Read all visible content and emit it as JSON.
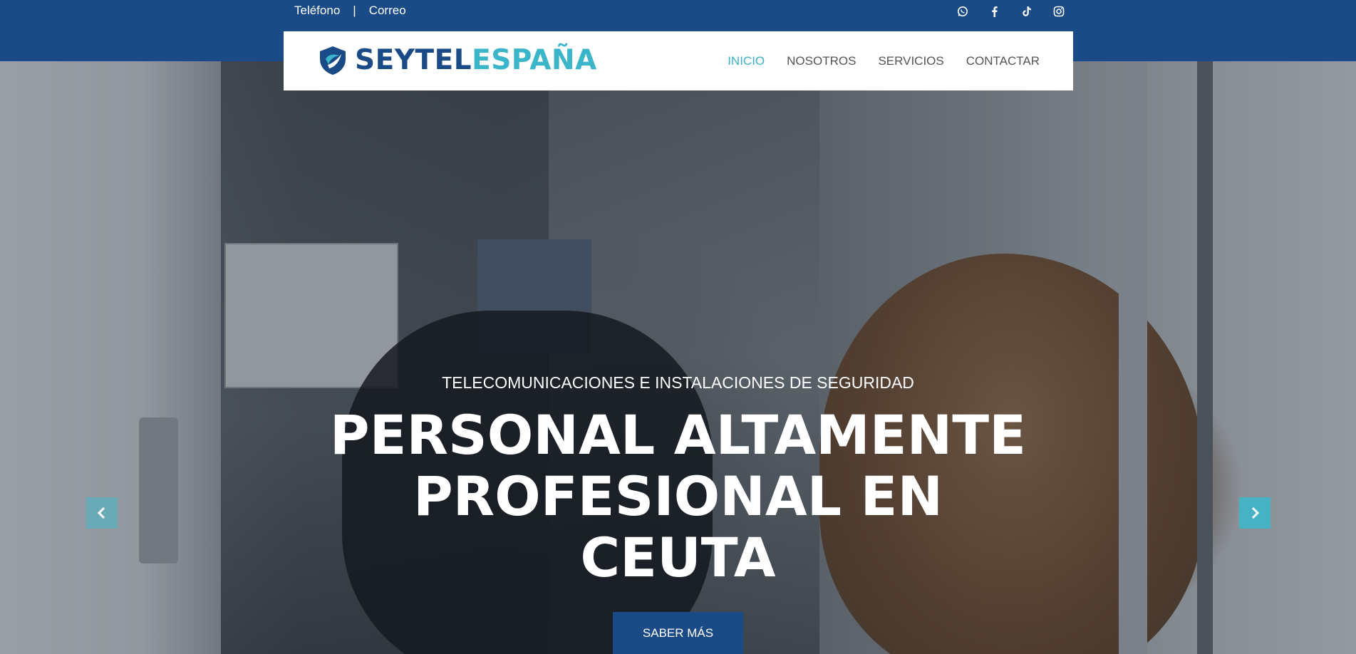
{
  "topbar": {
    "phone_label": "Teléfono",
    "separator": "|",
    "email_label": "Correo",
    "social_icons": [
      "whatsapp-icon",
      "facebook-icon",
      "tiktok-icon",
      "instagram-icon"
    ]
  },
  "header": {
    "logo_part1": "SEYTEL",
    "logo_part2": "ESPAÑA",
    "nav": [
      {
        "label": "INICIO",
        "active": true
      },
      {
        "label": "NOSOTROS"
      },
      {
        "label": "SERVICIOS"
      },
      {
        "label": "CONTACTAR"
      }
    ]
  },
  "hero": {
    "subtitle": "TELECOMUNICACIONES E INSTALACIONES DE SEGURIDAD",
    "title_line1": "PERSONAL ALTAMENTE",
    "title_line2": "PROFESIONAL EN",
    "title_line3": "CEUTA",
    "cta_label": "SABER MÁS",
    "prev_icon": "chevron-left-icon",
    "next_icon": "chevron-right-icon"
  },
  "colors": {
    "brand_dark": "#1b4b86",
    "brand_light": "#3bb5c9",
    "nav_text": "#555555"
  }
}
